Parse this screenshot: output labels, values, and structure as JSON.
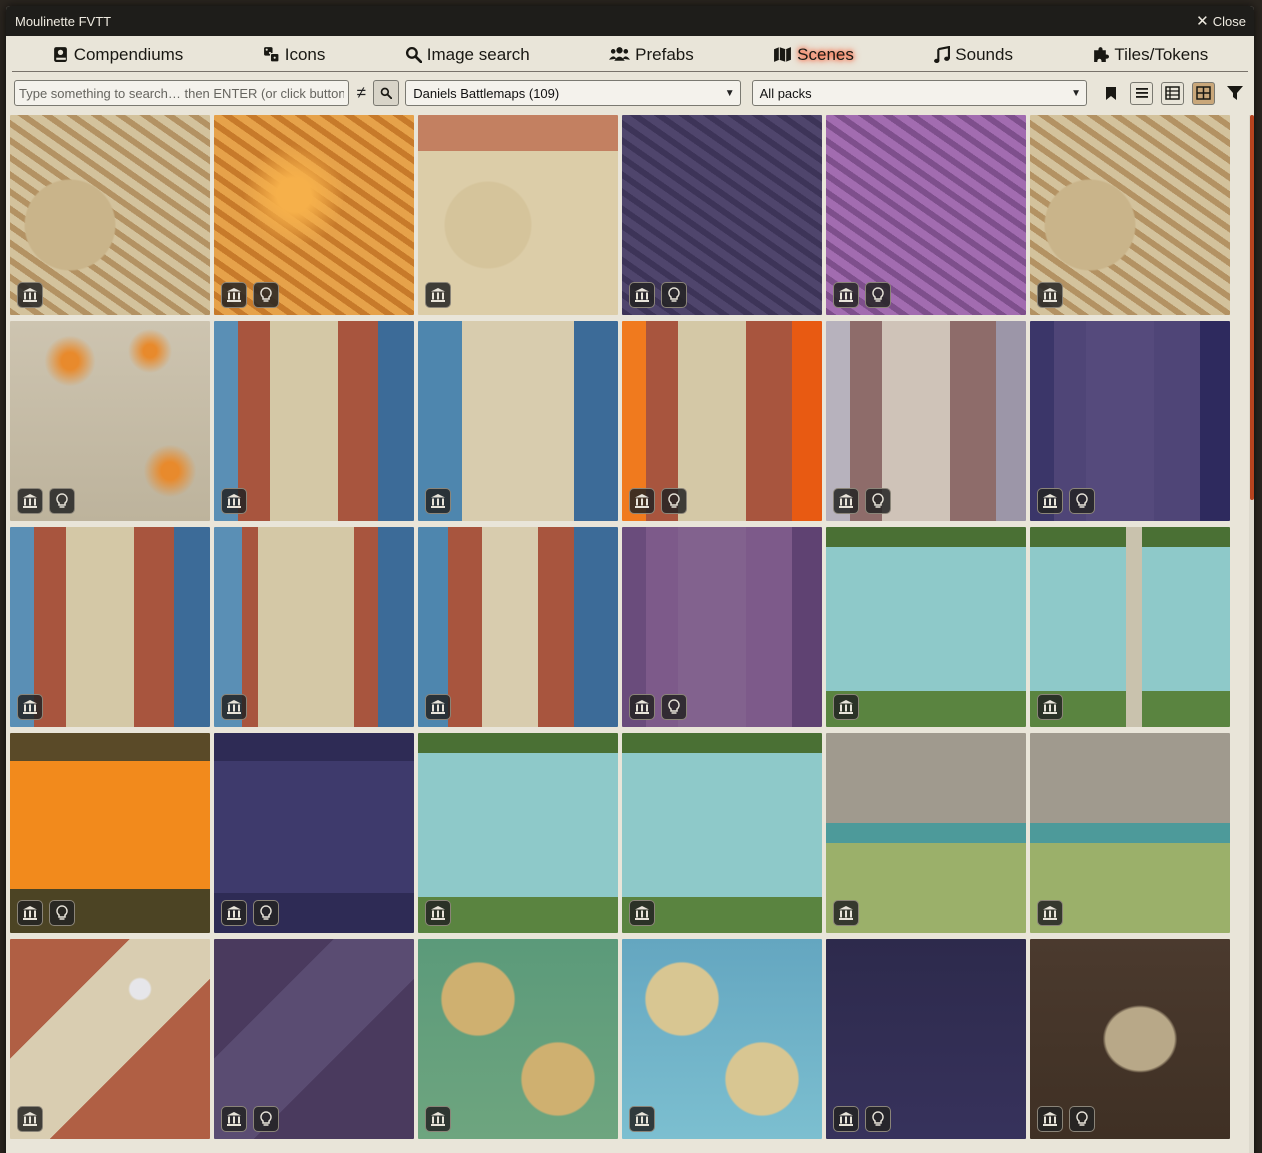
{
  "window": {
    "title": "Moulinette FVTT",
    "close_label": "Close"
  },
  "tabs": [
    {
      "label": "Compendiums",
      "icon": "book-icon",
      "active": false
    },
    {
      "label": "Icons",
      "icon": "dice-icon",
      "active": false
    },
    {
      "label": "Image search",
      "icon": "search-icon",
      "active": false
    },
    {
      "label": "Prefabs",
      "icon": "users-icon",
      "active": false
    },
    {
      "label": "Scenes",
      "icon": "map-icon",
      "active": true
    },
    {
      "label": "Sounds",
      "icon": "music-icon",
      "active": false
    },
    {
      "label": "Tiles/Tokens",
      "icon": "puzzle-icon",
      "active": false
    }
  ],
  "toolbar": {
    "search_placeholder": "Type something to search… then ENTER (or click button)",
    "search_value": "",
    "negate_symbol": "≠",
    "creator_select": "Daniels Battlemaps (109)",
    "pack_select": "All packs"
  },
  "colors": {
    "accent": "#c9a77a",
    "window_bg": "#e9e5d9",
    "titlebar_bg": "#1e1d1a",
    "scroll": "#b8431e"
  },
  "tiles": [
    {
      "style": "town-day",
      "badges": [
        "museum-icon"
      ]
    },
    {
      "style": "town-fire",
      "badges": [
        "museum-icon",
        "bulb-icon"
      ]
    },
    {
      "style": "town-empty",
      "badges": [
        "museum-icon"
      ]
    },
    {
      "style": "town-night",
      "badges": [
        "museum-icon",
        "bulb-icon"
      ]
    },
    {
      "style": "town-magic",
      "badges": [
        "museum-icon",
        "bulb-icon"
      ]
    },
    {
      "style": "town-day",
      "badges": [
        "museum-icon"
      ]
    },
    {
      "style": "rocks-fire",
      "badges": [
        "museum-icon",
        "bulb-icon"
      ]
    },
    {
      "style": "market-water",
      "badges": [
        "museum-icon"
      ]
    },
    {
      "style": "bridge-empty",
      "badges": [
        "museum-icon"
      ]
    },
    {
      "style": "market-lava",
      "badges": [
        "museum-icon",
        "bulb-icon"
      ]
    },
    {
      "style": "market-ghost",
      "badges": [
        "museum-icon",
        "bulb-icon"
      ]
    },
    {
      "style": "market-night",
      "badges": [
        "museum-icon",
        "bulb-icon"
      ]
    },
    {
      "style": "market-water",
      "badges": [
        "museum-icon"
      ]
    },
    {
      "style": "market-water2",
      "badges": [
        "museum-icon"
      ]
    },
    {
      "style": "bridge-houses",
      "badges": [
        "museum-icon"
      ]
    },
    {
      "style": "market-purple",
      "badges": [
        "museum-icon",
        "bulb-icon"
      ]
    },
    {
      "style": "river-jungle",
      "badges": [
        "museum-icon"
      ]
    },
    {
      "style": "river-jungle2",
      "badges": [
        "museum-icon"
      ]
    },
    {
      "style": "lava-river",
      "badges": [
        "museum-icon",
        "bulb-icon"
      ]
    },
    {
      "style": "night-river",
      "badges": [
        "museum-icon",
        "bulb-icon"
      ]
    },
    {
      "style": "river-jungle",
      "badges": [
        "museum-icon"
      ]
    },
    {
      "style": "river-jungle",
      "badges": [
        "museum-icon"
      ]
    },
    {
      "style": "castle-grass",
      "badges": [
        "museum-icon"
      ]
    },
    {
      "style": "castle-grass",
      "badges": [
        "museum-icon"
      ]
    },
    {
      "style": "plaza-day",
      "badges": [
        "museum-icon"
      ]
    },
    {
      "style": "plaza-night",
      "badges": [
        "museum-icon",
        "bulb-icon"
      ]
    },
    {
      "style": "swamp",
      "badges": [
        "museum-icon"
      ]
    },
    {
      "style": "lagoon",
      "badges": [
        "museum-icon"
      ]
    },
    {
      "style": "dark-night",
      "badges": [
        "museum-icon",
        "bulb-icon"
      ]
    },
    {
      "style": "cave",
      "badges": [
        "museum-icon",
        "bulb-icon"
      ]
    }
  ]
}
